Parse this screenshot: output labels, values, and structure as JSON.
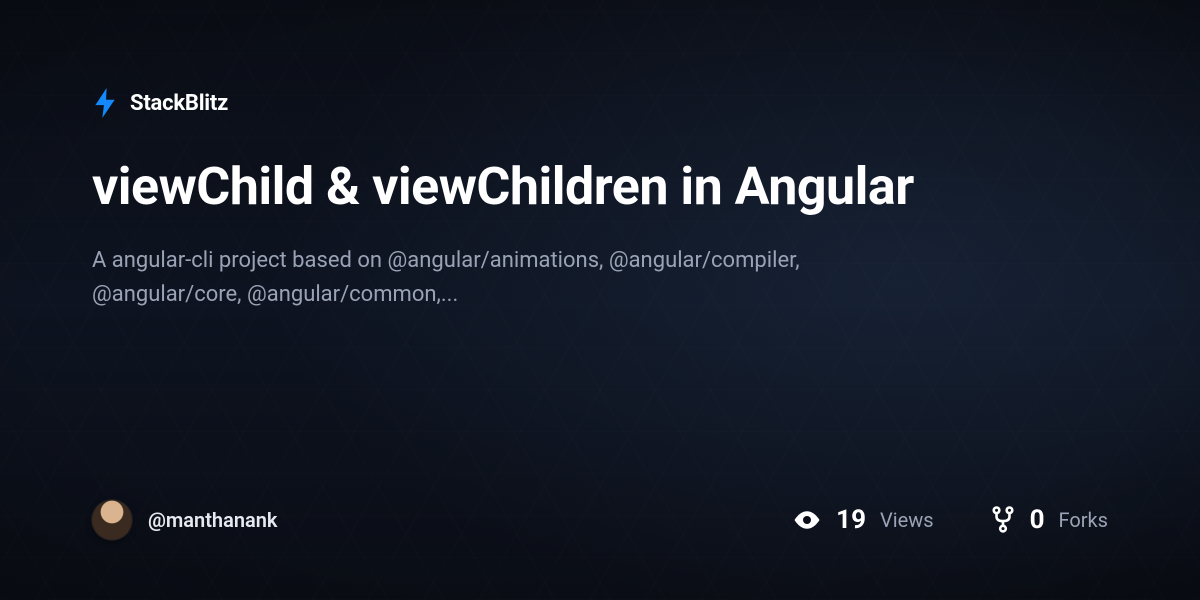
{
  "brand": {
    "name": "StackBlitz",
    "accent": "#1389fd"
  },
  "project": {
    "title": "viewChild & viewChildren in Angular",
    "description": "A angular-cli project based on @angular/animations, @angular/compiler, @angular/core, @angular/common,..."
  },
  "author": {
    "handle": "@manthanank"
  },
  "stats": {
    "views": {
      "count": "19",
      "label": "Views"
    },
    "forks": {
      "count": "0",
      "label": "Forks"
    }
  }
}
